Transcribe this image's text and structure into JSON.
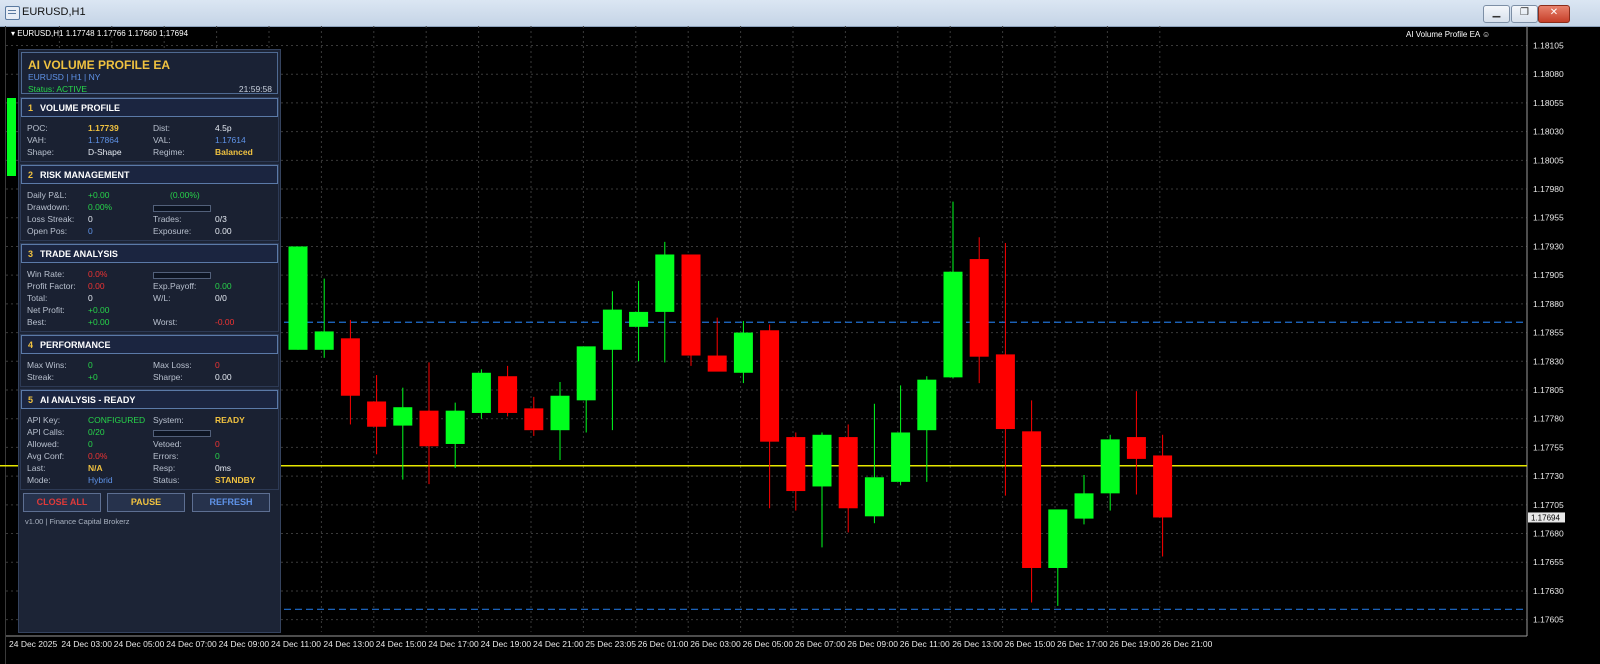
{
  "window": {
    "title": "EURUSD,H1"
  },
  "chart_header": {
    "symbol_line": "▾ EURUSD,H1  1.17748 1.17766 1.17660 1.17694",
    "ea_label": "AI Volume Profile EA ☺"
  },
  "price_axis": {
    "labels": [
      "1.18105",
      "1.18080",
      "1.18055",
      "1.18030",
      "1.18005",
      "1.17980",
      "1.17955",
      "1.17930",
      "1.17905",
      "1.17880",
      "1.17855",
      "1.17830",
      "1.17805",
      "1.17780",
      "1.17755",
      "1.17730",
      "1.17705",
      "1.17680",
      "1.17655",
      "1.17630",
      "1.17605"
    ],
    "current_price": "1.17694"
  },
  "time_axis": {
    "labels": [
      "24 Dec 2025",
      "24 Dec 03:00",
      "24 Dec 05:00",
      "24 Dec 07:00",
      "24 Dec 09:00",
      "24 Dec 11:00",
      "24 Dec 13:00",
      "24 Dec 15:00",
      "24 Dec 17:00",
      "24 Dec 19:00",
      "24 Dec 21:00",
      "25 Dec 23:05",
      "26 Dec 01:00",
      "26 Dec 03:00",
      "26 Dec 05:00",
      "26 Dec 07:00",
      "26 Dec 09:00",
      "26 Dec 11:00",
      "26 Dec 13:00",
      "26 Dec 15:00",
      "26 Dec 17:00",
      "26 Dec 19:00",
      "26 Dec 21:00"
    ]
  },
  "colors": {
    "bull": "#00ff1e",
    "bear": "#ff0000",
    "poc_line": "#e6e600",
    "va_line": "#1f6fd1",
    "accent": "#f0c240"
  },
  "chart_data": {
    "type": "candlestick",
    "price_range": [
      1.17596,
      1.18115
    ],
    "levels": {
      "poc": 1.17739,
      "vah": 1.17864,
      "val": 1.17614
    },
    "candles": [
      {
        "o": 1.1784,
        "h": 1.1793,
        "l": 1.1784,
        "c": 1.1793
      },
      {
        "o": 1.1784,
        "h": 1.17902,
        "l": 1.17833,
        "c": 1.17856
      },
      {
        "o": 1.1785,
        "h": 1.17866,
        "l": 1.17775,
        "c": 1.178
      },
      {
        "o": 1.17795,
        "h": 1.17818,
        "l": 1.17749,
        "c": 1.17773
      },
      {
        "o": 1.17774,
        "h": 1.17807,
        "l": 1.17727,
        "c": 1.1779
      },
      {
        "o": 1.17787,
        "h": 1.17829,
        "l": 1.17723,
        "c": 1.17756
      },
      {
        "o": 1.17758,
        "h": 1.17794,
        "l": 1.17737,
        "c": 1.17787
      },
      {
        "o": 1.17785,
        "h": 1.17823,
        "l": 1.1778,
        "c": 1.1782
      },
      {
        "o": 1.17817,
        "h": 1.17826,
        "l": 1.17782,
        "c": 1.17785
      },
      {
        "o": 1.17789,
        "h": 1.17799,
        "l": 1.17765,
        "c": 1.1777
      },
      {
        "o": 1.1777,
        "h": 1.17812,
        "l": 1.17744,
        "c": 1.178
      },
      {
        "o": 1.17796,
        "h": 1.17842,
        "l": 1.17768,
        "c": 1.17843
      },
      {
        "o": 1.1784,
        "h": 1.17891,
        "l": 1.1777,
        "c": 1.17875
      },
      {
        "o": 1.1786,
        "h": 1.179,
        "l": 1.1783,
        "c": 1.17873
      },
      {
        "o": 1.17873,
        "h": 1.17934,
        "l": 1.17829,
        "c": 1.17923
      },
      {
        "o": 1.17923,
        "h": 1.17923,
        "l": 1.17826,
        "c": 1.17835
      },
      {
        "o": 1.17835,
        "h": 1.17868,
        "l": 1.17822,
        "c": 1.17821
      },
      {
        "o": 1.1782,
        "h": 1.17865,
        "l": 1.17811,
        "c": 1.17855
      },
      {
        "o": 1.17857,
        "h": 1.17862,
        "l": 1.17702,
        "c": 1.1776
      },
      {
        "o": 1.17764,
        "h": 1.17768,
        "l": 1.177,
        "c": 1.17717
      },
      {
        "o": 1.17721,
        "h": 1.17768,
        "l": 1.17668,
        "c": 1.17766
      },
      {
        "o": 1.17764,
        "h": 1.17775,
        "l": 1.17681,
        "c": 1.17702
      },
      {
        "o": 1.17695,
        "h": 1.17793,
        "l": 1.17689,
        "c": 1.17729
      },
      {
        "o": 1.17725,
        "h": 1.17809,
        "l": 1.17722,
        "c": 1.17768
      },
      {
        "o": 1.1777,
        "h": 1.17817,
        "l": 1.17725,
        "c": 1.17814
      },
      {
        "o": 1.17816,
        "h": 1.17969,
        "l": 1.17815,
        "c": 1.17908
      },
      {
        "o": 1.17919,
        "h": 1.17938,
        "l": 1.17811,
        "c": 1.17834
      },
      {
        "o": 1.17836,
        "h": 1.17933,
        "l": 1.17713,
        "c": 1.17771
      },
      {
        "o": 1.17769,
        "h": 1.17796,
        "l": 1.1762,
        "c": 1.1765
      },
      {
        "o": 1.1765,
        "h": 1.177,
        "l": 1.17617,
        "c": 1.17701
      },
      {
        "o": 1.17693,
        "h": 1.17731,
        "l": 1.17688,
        "c": 1.17715
      },
      {
        "o": 1.17715,
        "h": 1.17766,
        "l": 1.177,
        "c": 1.17762
      },
      {
        "o": 1.17764,
        "h": 1.17804,
        "l": 1.17714,
        "c": 1.17745
      },
      {
        "o": 1.17748,
        "h": 1.17766,
        "l": 1.1766,
        "c": 1.17694
      }
    ]
  },
  "panel": {
    "title": "AI VOLUME PROFILE EA",
    "subtitle": "EURUSD | H1 | NY",
    "status": "Status: ACTIVE",
    "clock": "21:59:58",
    "s1": {
      "num": "1",
      "title": "VOLUME PROFILE",
      "r1": [
        "POC:",
        "1.17739",
        "Dist:",
        "4.5p"
      ],
      "r2": [
        "VAH:",
        "1.17864",
        "VAL:",
        "1.17614"
      ],
      "r3": [
        "Shape:",
        "D-Shape",
        "Regime:",
        "Balanced"
      ]
    },
    "s2": {
      "num": "2",
      "title": "RISK MANAGEMENT",
      "r1": [
        "Daily P&L:",
        "+0.00",
        "(0.00%)"
      ],
      "r2": [
        "Drawdown:",
        "0.00%"
      ],
      "r3": [
        "Loss Streak:",
        "0",
        "Trades:",
        "0/3"
      ],
      "r4": [
        "Open Pos:",
        "0",
        "Exposure:",
        "0.00"
      ],
      "drawdown_fill": 0
    },
    "s3": {
      "num": "3",
      "title": "TRADE ANALYSIS",
      "r1": [
        "Win Rate:",
        "0.0%"
      ],
      "r2": [
        "Profit Factor:",
        "0.00",
        "Exp.Payoff:",
        "0.00"
      ],
      "r3": [
        "Total:",
        "0",
        "W/L:",
        "0/0"
      ],
      "r4": [
        "Net Profit:",
        "+0.00"
      ],
      "r5": [
        "Best:",
        "+0.00",
        "Worst:",
        "-0.00"
      ],
      "winrate_fill": 0
    },
    "s4": {
      "num": "4",
      "title": "PERFORMANCE",
      "r1": [
        "Max Wins:",
        "0",
        "Max Loss:",
        "0"
      ],
      "r2": [
        "Streak:",
        "+0",
        "Sharpe:",
        "0.00"
      ]
    },
    "s5": {
      "num": "5",
      "title": "AI ANALYSIS - READY",
      "r1": [
        "API Key:",
        "CONFIGURED",
        "System:",
        "READY"
      ],
      "r2": [
        "API Calls:",
        "0/20"
      ],
      "r3": [
        "Allowed:",
        "0",
        "Vetoed:",
        "0"
      ],
      "r4": [
        "Avg Conf:",
        "0.0%",
        "Errors:",
        "0"
      ],
      "r5": [
        "Last:",
        "N/A",
        "Resp:",
        "0ms"
      ],
      "r6": [
        "Mode:",
        "Hybrid",
        "Status:",
        "STANDBY"
      ],
      "api_fill": 0
    },
    "buttons": {
      "close_all": "CLOSE ALL",
      "pause": "PAUSE",
      "refresh": "REFRESH"
    },
    "footer": "v1.00 | Finance Capital Brokerz"
  }
}
